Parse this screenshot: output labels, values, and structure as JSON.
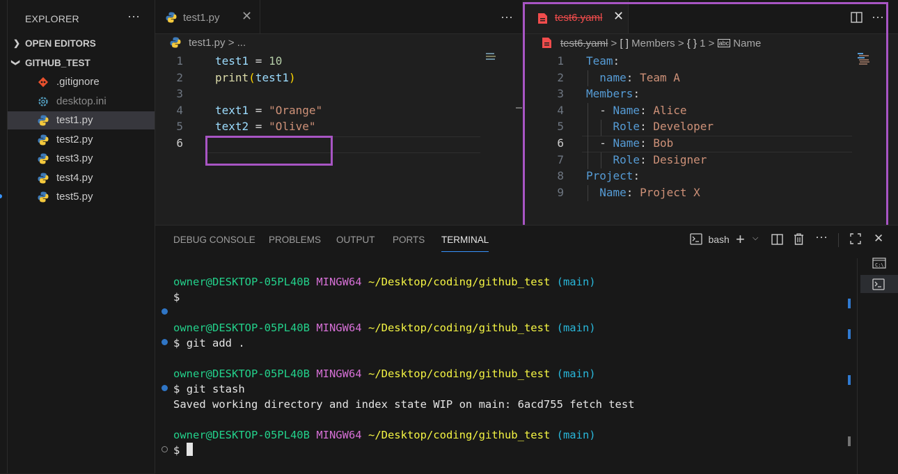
{
  "sidebar": {
    "title": "EXPLORER",
    "more": "···",
    "open_editors": "OPEN EDITORS",
    "folder": "GITHUB_TEST",
    "files": [
      {
        "name": ".gitignore",
        "icon": "git-icon"
      },
      {
        "name": "desktop.ini",
        "icon": "gear-icon"
      },
      {
        "name": "test1.py",
        "icon": "python-icon"
      },
      {
        "name": "test2.py",
        "icon": "python-icon"
      },
      {
        "name": "test3.py",
        "icon": "python-icon"
      },
      {
        "name": "test4.py",
        "icon": "python-icon"
      },
      {
        "name": "test5.py",
        "icon": "python-icon"
      }
    ]
  },
  "left_editor": {
    "tab_label": "test1.py",
    "breadcrumb_file": "test1.py",
    "breadcrumb_sep": ">",
    "breadcrumb_more": "...",
    "line_numbers": [
      "1",
      "2",
      "3",
      "4",
      "5",
      "6"
    ],
    "lines": {
      "l1_var": "test1",
      "l1_op": " = ",
      "l1_num": "10",
      "l2_fn": "print",
      "l2_open": "(",
      "l2_arg": "test1",
      "l2_close": ")",
      "l4_var": "text1",
      "l4_op": " = ",
      "l4_str": "\"Orange\"",
      "l5_var": "text2",
      "l5_op": " = ",
      "l5_str": "\"Olive\""
    }
  },
  "right_editor": {
    "tab_label": "test6.yaml",
    "breadcrumb": {
      "file": "test6.yaml",
      "members": "Members",
      "index": "1",
      "name": "Name",
      "array_icon": "[ ]",
      "object_icon": "{ }",
      "string_icon": "abc"
    },
    "line_numbers": [
      "1",
      "2",
      "3",
      "4",
      "5",
      "6",
      "7",
      "8",
      "9"
    ],
    "yaml": {
      "team_key": "Team",
      "name_key": "name",
      "team_val": "Team A",
      "members_key": "Members",
      "m1_name_key": "Name",
      "m1_name_val": "Alice",
      "m1_role_key": "Role",
      "m1_role_val": "Developer",
      "m2_name_key": "Name",
      "m2_name_val": "Bob",
      "m2_role_key": "Role",
      "m2_role_val": "Designer",
      "project_key": "Project",
      "pname_key": "Name",
      "pname_val": "Project X"
    }
  },
  "panel": {
    "tabs": [
      "DEBUG CONSOLE",
      "PROBLEMS",
      "OUTPUT",
      "PORTS",
      "TERMINAL"
    ],
    "active_tab": "TERMINAL",
    "shell": "bash",
    "terminal": {
      "user": "owner@DESKTOP-05PL40B",
      "env": "MINGW64",
      "path": "~/Desktop/coding/github_test",
      "branch": "(main)",
      "prompt": "$",
      "cmd1": "git add .",
      "cmd2": "git stash",
      "output": "Saved working directory and index state WIP on main: 6acd755 fetch test"
    }
  },
  "colors": {
    "highlight": "#a855c4",
    "accent": "#3794ff",
    "yaml_tab": "#f14c4c"
  }
}
